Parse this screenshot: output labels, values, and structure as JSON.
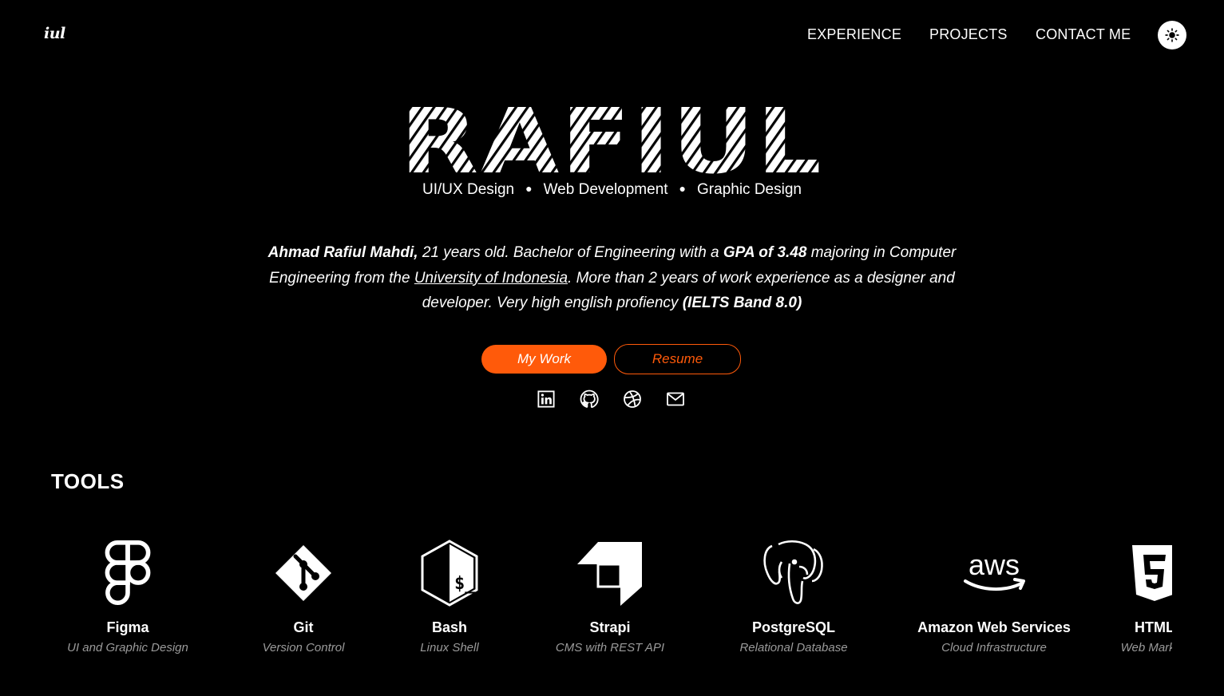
{
  "header": {
    "logo": "iul",
    "nav": [
      {
        "label": "EXPERIENCE"
      },
      {
        "label": "PROJECTS"
      },
      {
        "label": "CONTACT ME"
      }
    ],
    "theme_toggle_icon": "sun-icon"
  },
  "hero": {
    "title": "RAFIUL",
    "roles": [
      "UI/UX Design",
      "Web Development",
      "Graphic Design"
    ],
    "bio": {
      "name": "Ahmad Rafiul Mahdi,",
      "part1": " 21 years old. Bachelor of Engineering with a ",
      "gpa": "GPA of 3.48",
      "part2": " majoring in Computer Engineering from the ",
      "university": "University of Indonesia",
      "part3": ". More than 2 years of work experience as a designer and developer. Very high english profiency ",
      "ielts": "(IELTS Band 8.0)"
    },
    "buttons": {
      "primary": "My Work",
      "secondary": "Resume"
    },
    "social": [
      "linkedin-icon",
      "github-icon",
      "dribbble-icon",
      "mail-icon"
    ]
  },
  "tools": {
    "heading": "TOOLS",
    "items": [
      {
        "name": "Figma",
        "desc": "UI and Graphic Design",
        "icon": "figma-icon"
      },
      {
        "name": "Git",
        "desc": "Version Control",
        "icon": "git-icon"
      },
      {
        "name": "Bash",
        "desc": "Linux Shell",
        "icon": "bash-icon"
      },
      {
        "name": "Strapi",
        "desc": "CMS with REST API",
        "icon": "strapi-icon"
      },
      {
        "name": "PostgreSQL",
        "desc": "Relational Database",
        "icon": "postgresql-icon"
      },
      {
        "name": "Amazon Web Services",
        "desc": "Cloud Infrastructure",
        "icon": "aws-icon"
      },
      {
        "name": "HTML",
        "desc": "Web Markup",
        "icon": "html5-icon"
      }
    ]
  },
  "colors": {
    "accent": "#ff5a0a",
    "background": "#000000",
    "text": "#ffffff",
    "muted": "#9a9a9a"
  }
}
